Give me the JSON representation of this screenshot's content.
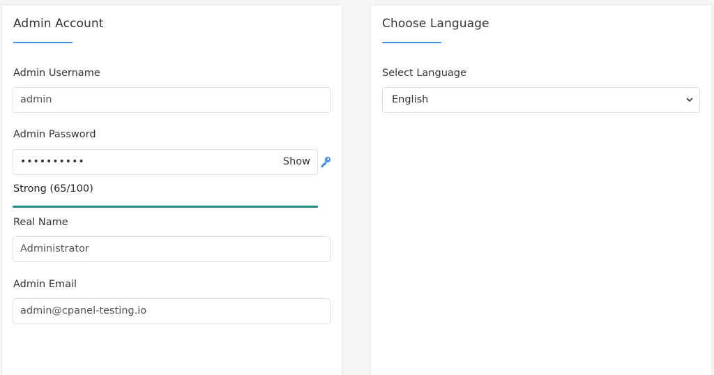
{
  "admin_account": {
    "title": "Admin Account",
    "username": {
      "label": "Admin Username",
      "value": "admin"
    },
    "password": {
      "label": "Admin Password",
      "value": "••••••••••",
      "show_label": "Show",
      "strength_text": "Strong (65/100)",
      "strength_color": "#1a8f80",
      "strength_fraction": 1.0
    },
    "real_name": {
      "label": "Real Name",
      "value": "Administrator"
    },
    "email": {
      "label": "Admin Email",
      "value": "admin@cpanel-testing.io"
    }
  },
  "language": {
    "title": "Choose Language",
    "select": {
      "label": "Select Language",
      "value": "English"
    }
  },
  "colors": {
    "accent": "#4a90e2",
    "strength": "#1a8f80"
  },
  "icons": {
    "generate_password": "key-icon",
    "select_arrow": "chevron-down-icon"
  }
}
